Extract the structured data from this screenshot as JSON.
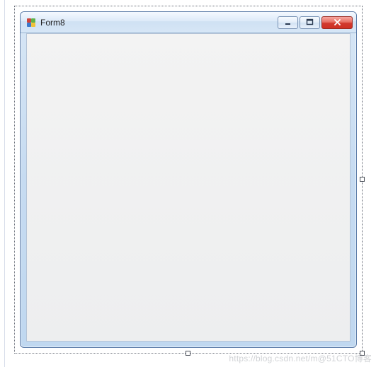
{
  "window": {
    "title": "Form8"
  },
  "control_buttons": {
    "minimize": "minimize",
    "maximize": "maximize",
    "close": "close"
  },
  "watermark": "https://blog.csdn.net/m@51CTO博客"
}
